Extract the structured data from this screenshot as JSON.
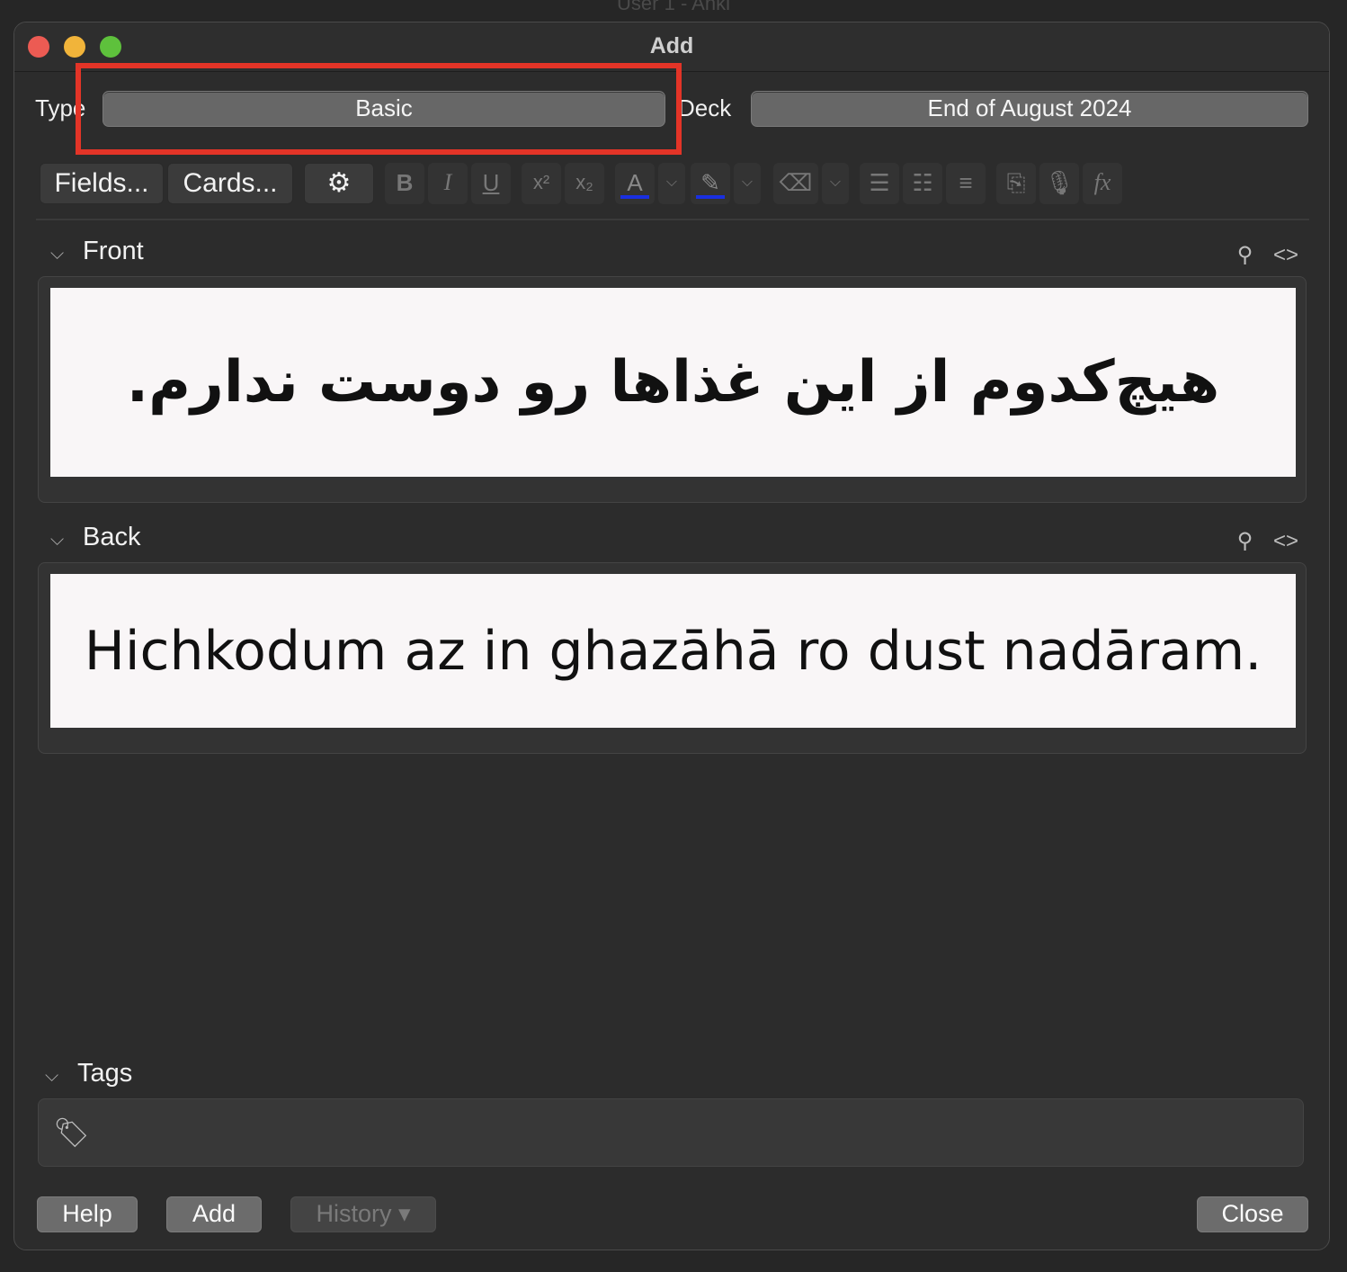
{
  "background_title": "User 1 - Anki",
  "window": {
    "title": "Add"
  },
  "header": {
    "type_label": "Type",
    "note_type": "Basic",
    "deck_label": "Deck",
    "deck": "End of August 2024"
  },
  "toolbar": {
    "fields_label": "Fields...",
    "cards_label": "Cards...",
    "bold": "B",
    "italic": "I",
    "underline": "U",
    "superscript": "x²",
    "subscript": "x₂",
    "text_color_letter": "A",
    "mathjax": "fx",
    "text_color": "#1a2fe0",
    "highlight_color": "#1a2fe0"
  },
  "fields": {
    "front": {
      "label": "Front",
      "content": "هیچ‌کدوم از این غذاها رو دوست ندارم."
    },
    "back": {
      "label": "Back",
      "content": "Hichkodum az in ghazāhā ro dust nadāram."
    }
  },
  "tags": {
    "label": "Tags"
  },
  "footer": {
    "help_label": "Help",
    "add_label": "Add",
    "history_label": "History ▾",
    "close_label": "Close"
  }
}
